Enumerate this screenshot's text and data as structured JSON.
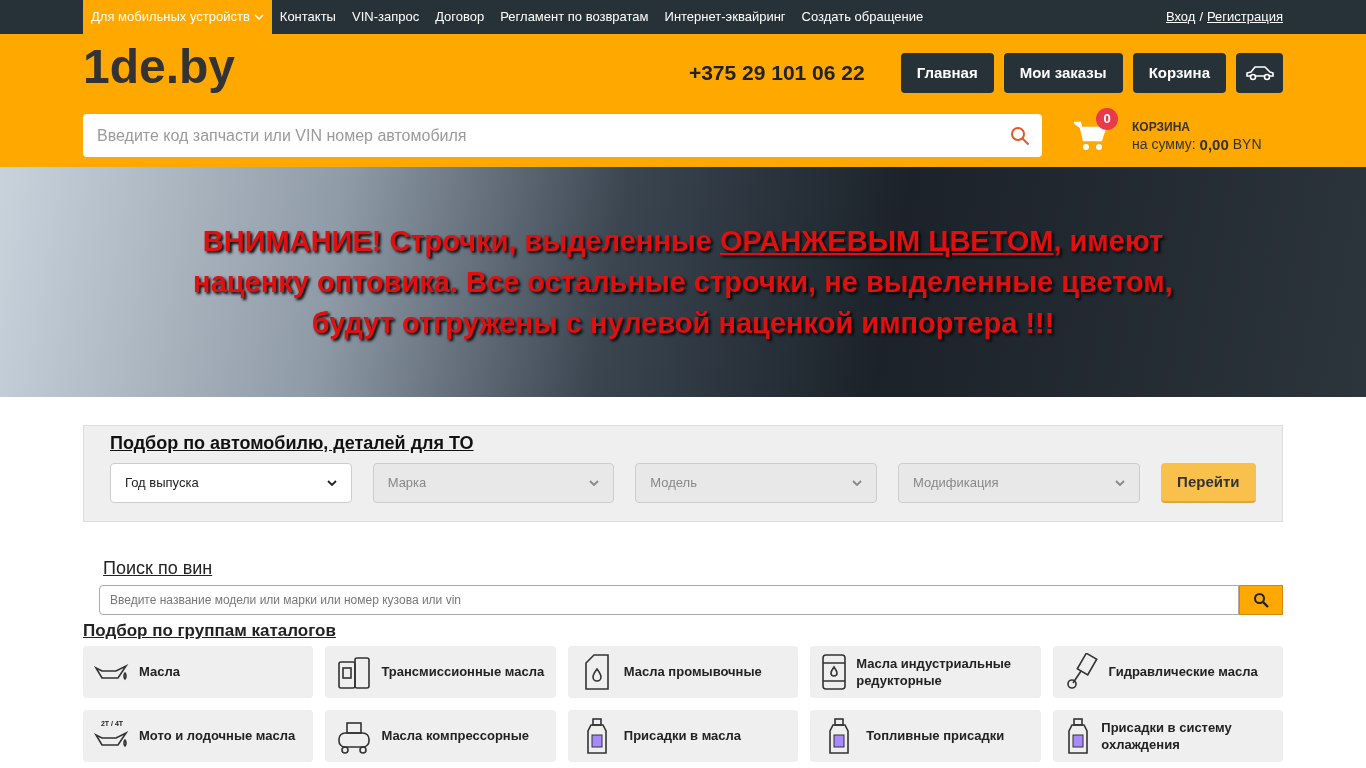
{
  "top_nav": {
    "items": [
      {
        "label": "Для мобильных устройств",
        "selected": true,
        "has_dropdown": true
      },
      {
        "label": "Контакты",
        "selected": false,
        "has_dropdown": false
      },
      {
        "label": "VIN-запрос",
        "selected": false,
        "has_dropdown": false
      },
      {
        "label": "Договор",
        "selected": false,
        "has_dropdown": false
      },
      {
        "label": "Регламент по возвратам",
        "selected": false,
        "has_dropdown": false
      },
      {
        "label": "Интернет-эквайринг",
        "selected": false,
        "has_dropdown": false
      },
      {
        "label": "Создать обращение",
        "selected": false,
        "has_dropdown": false
      }
    ],
    "login": "Вход",
    "separator": "/",
    "register": "Регистрация"
  },
  "header": {
    "logo": "1de.by",
    "phone": "+375 29 101 06 22",
    "buttons": [
      "Главная",
      "Мои заказы",
      "Корзина"
    ],
    "search": {
      "placeholder": "Введите код запчасти или VIN номер автомобиля"
    },
    "cart": {
      "count": "0",
      "title": "КОРЗИНА",
      "sum_label": "на сумму:",
      "sum": "0,00",
      "currency": "BYN"
    }
  },
  "banner": {
    "before": "ВНИМАНИЕ! Строчки, выделенные ",
    "link": "ОРАНЖЕВЫМ ЦВЕТОМ",
    "after": ", имеют наценку оптовика. Все остальные строчки, не выделенные цветом, будут отгружены с нулевой наценкой импортера !!!"
  },
  "car_picker": {
    "title": "Подбор по автомобилю, деталей для ТО",
    "selects": [
      {
        "value": "Год выпуска",
        "disabled": false
      },
      {
        "value": "Марка",
        "disabled": true
      },
      {
        "value": "Модель",
        "disabled": true
      },
      {
        "value": "Модификация",
        "disabled": true
      }
    ],
    "button": "Перейти"
  },
  "vin_search": {
    "title": "Поиск по вин",
    "placeholder": "Введите название модели или марки или номер кузова или vin"
  },
  "catalog": {
    "title": "Подбор по группам каталогов",
    "items": [
      {
        "label": "Масла",
        "kind": "oilcan"
      },
      {
        "label": "Трансмиссионные масла",
        "kind": "canisters"
      },
      {
        "label": "Масла промывочные",
        "kind": "canister"
      },
      {
        "label": "Масла индустриальные редукторные",
        "kind": "barrel"
      },
      {
        "label": "Гидравлические масла",
        "kind": "piston"
      },
      {
        "label": "Мото и лодочные масла",
        "kind": "oilcan",
        "icon_text": "2T / 4T"
      },
      {
        "label": "Масла компрессорные",
        "kind": "compressor"
      },
      {
        "label": "Присадки в масла",
        "kind": "bottle"
      },
      {
        "label": "Топливные присадки",
        "kind": "bottle"
      },
      {
        "label": "Присадки в систему охлаждения",
        "kind": "bottle"
      }
    ]
  }
}
